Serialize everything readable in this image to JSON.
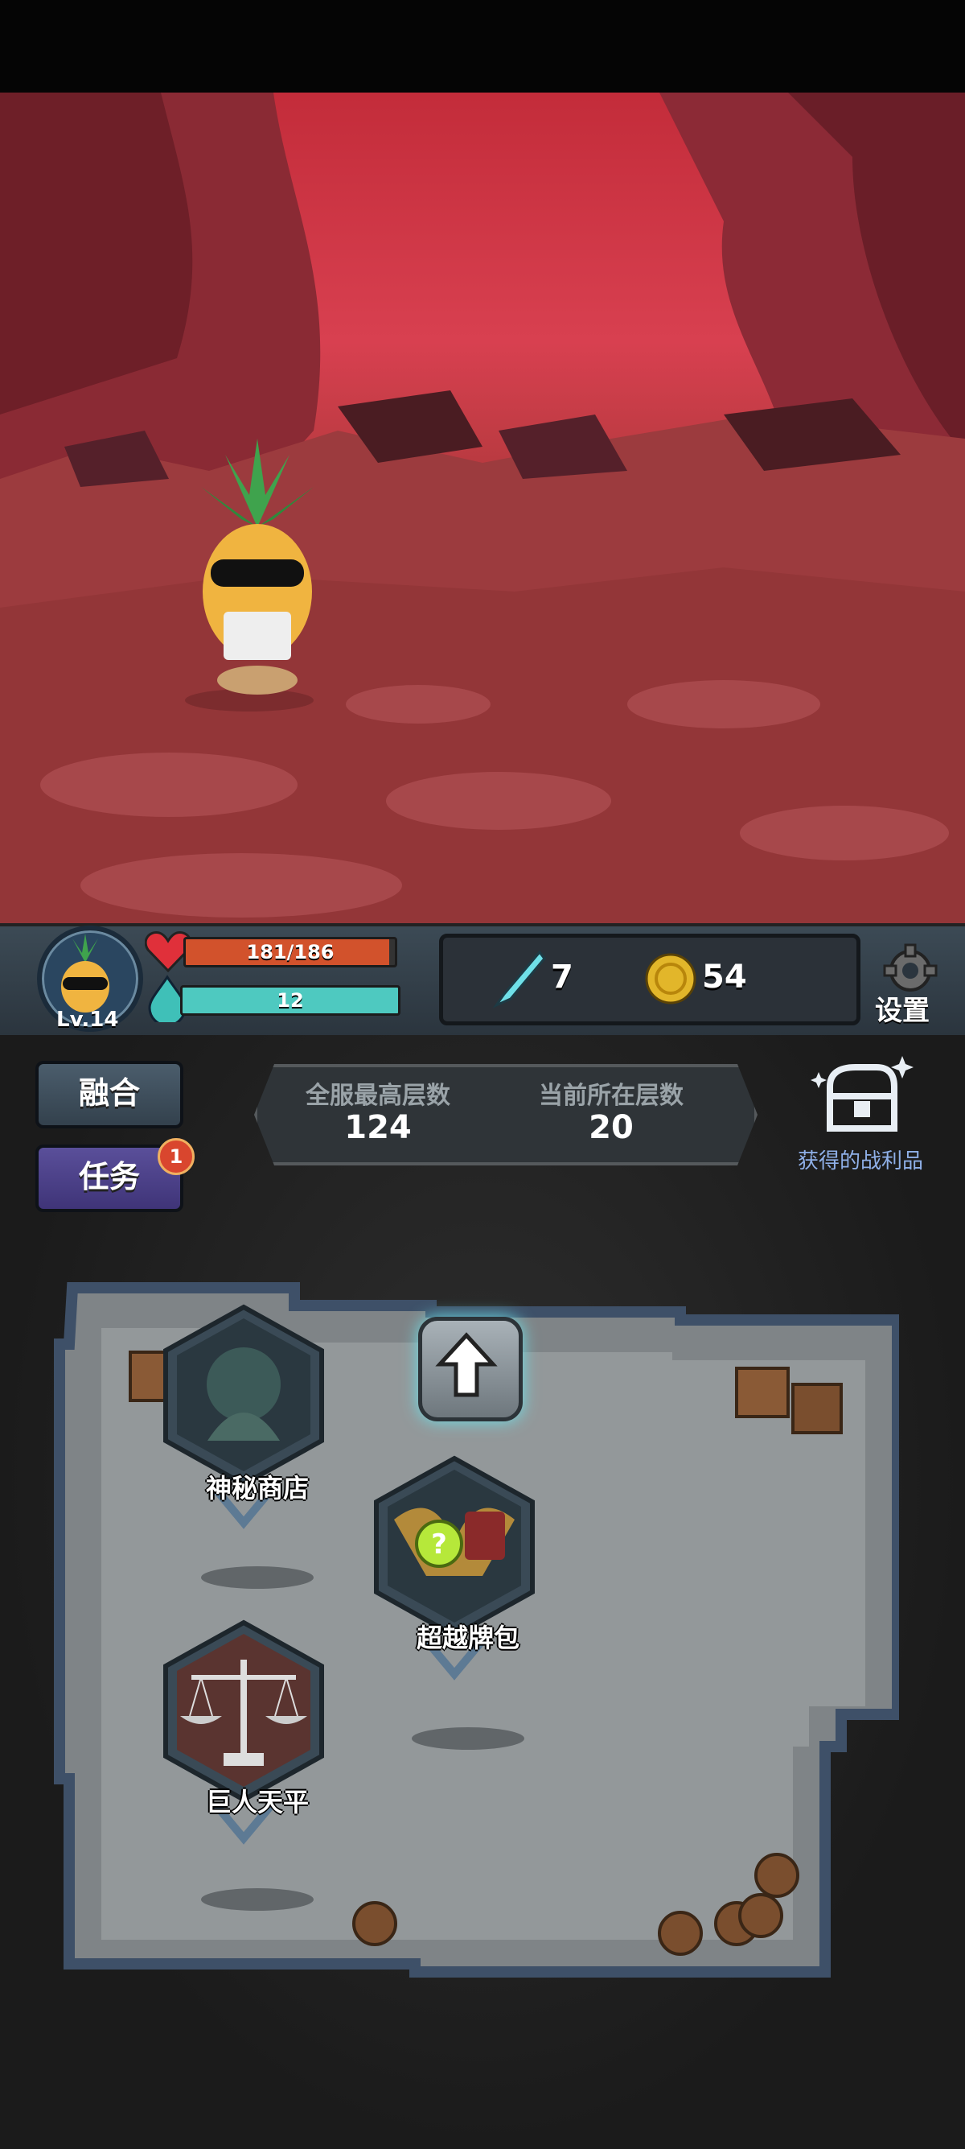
{
  "player": {
    "level": "Lv.14"
  },
  "stats": {
    "hp": "181/186",
    "hp_fraction": 0.973,
    "mana": "12",
    "mana_fraction": 1.0
  },
  "resources": {
    "gems": "7",
    "coins": "54"
  },
  "settings_label": "设置",
  "menu": {
    "fusion": "融合",
    "tasks": "任务",
    "tasks_badge": "1"
  },
  "floors": {
    "server_max_label": "全服最高层数",
    "server_max_value": "124",
    "current_label": "当前所在层数",
    "current_value": "20"
  },
  "loot_label": "获得的战利品",
  "map_nodes": {
    "shop": "神秘商店",
    "card_pack": "超越牌包",
    "balance": "巨人天平"
  },
  "colors": {
    "hp": "#d2522c",
    "mana": "#4ec9c0",
    "tasks_button": "#4a3f88",
    "fusion_button": "#3a4a58",
    "loot_text": "#8fb0e8"
  }
}
